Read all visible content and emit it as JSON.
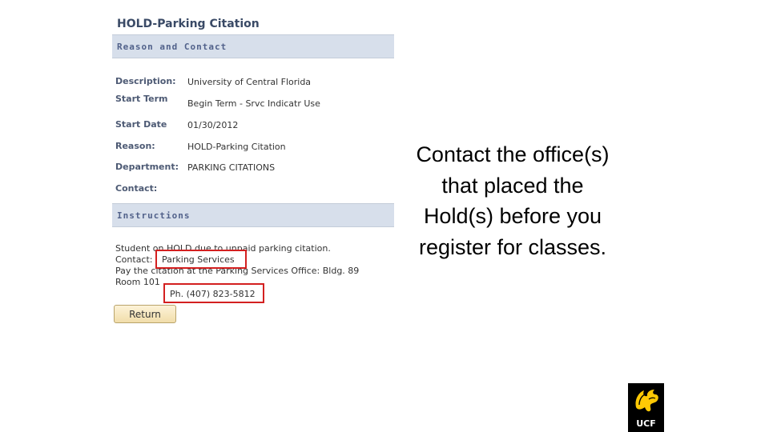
{
  "page": {
    "title": "HOLD-Parking Citation"
  },
  "reason_section": {
    "heading": "Reason and Contact",
    "rows": [
      {
        "label": "Description:",
        "value": "University of Central Florida"
      },
      {
        "label": "Start Term",
        "value": "Begin Term - Srvc Indicatr Use"
      },
      {
        "label": "Start Date",
        "value": "01/30/2012"
      },
      {
        "label": "Reason:",
        "value": "HOLD-Parking Citation"
      },
      {
        "label": "Department:",
        "value": "PARKING CITATIONS"
      },
      {
        "label": "Contact:",
        "value": ""
      }
    ]
  },
  "instructions_section": {
    "heading": "Instructions",
    "line1": "Student on HOLD due to unpaid parking citation.",
    "contact_label": "Contact:",
    "contact_value": "Parking Services",
    "line3": "Pay the citation at the Parking Services Office:  Bldg. 89",
    "line4": "Room 101",
    "phone": "Ph. (407) 823-5812"
  },
  "buttons": {
    "return_label": "Return"
  },
  "caption": {
    "line1": "Contact the office(s)",
    "line2": "that placed the",
    "line3": "Hold(s) before you",
    "line4": "register for classes."
  },
  "logo": {
    "text": "UCF"
  },
  "colors": {
    "section_bar": "#d7dfeb",
    "highlight_box": "#d32020",
    "label_text": "#4d5a74",
    "ucf_gold": "#ffc904"
  }
}
